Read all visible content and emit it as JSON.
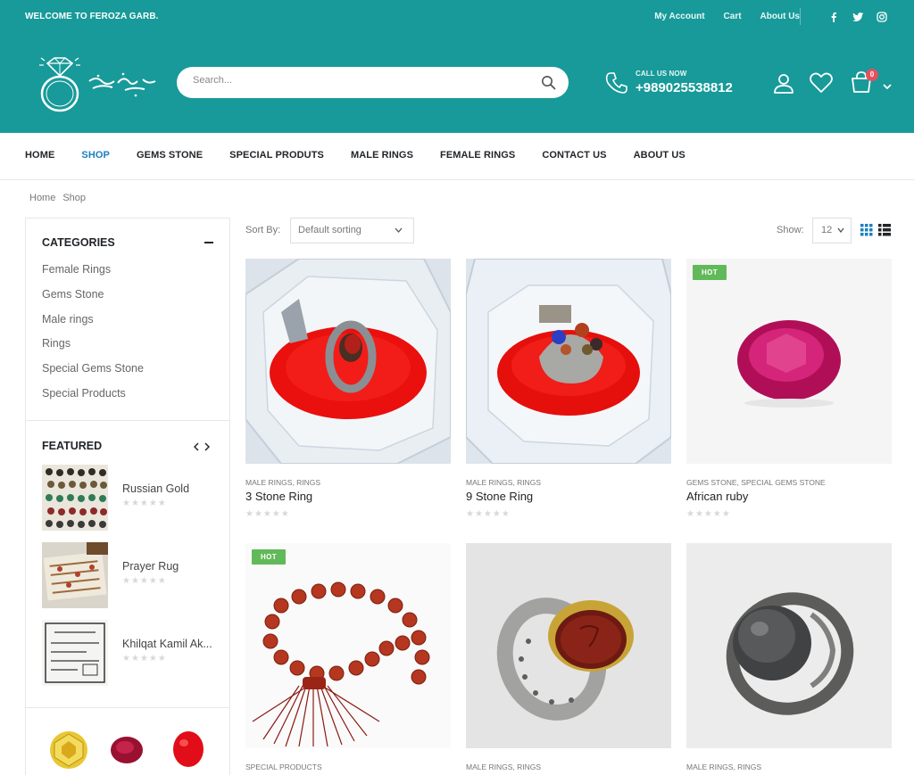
{
  "topbar": {
    "welcome": "WELCOME TO FEROZA GARB.",
    "links": [
      "My Account",
      "Cart",
      "About Us"
    ],
    "social_icons": [
      "facebook-icon",
      "twitter-icon",
      "instagram-icon"
    ]
  },
  "header": {
    "search_placeholder": "Search...",
    "call_label": "CALL US NOW",
    "phone": "+989025538812",
    "cart_count": "0"
  },
  "nav": {
    "items": [
      "HOME",
      "SHOP",
      "GEMS STONE",
      "SPECIAL PRODUTS",
      "MALE RINGS",
      "FEMALE RINGS",
      "CONTACT US",
      "ABOUT US"
    ],
    "active": "SHOP"
  },
  "breadcrumb": [
    "Home",
    "Shop"
  ],
  "sidebar": {
    "categories_title": "CATEGORIES",
    "categories": [
      "Female Rings",
      "Gems Stone",
      "Male rings",
      "Rings",
      "Special Gems Stone",
      "Special Products"
    ],
    "featured_title": "FEATURED",
    "featured": [
      {
        "name": "Russian Gold"
      },
      {
        "name": "Prayer Rug"
      },
      {
        "name": "Khilqat Kamil Ak..."
      }
    ]
  },
  "toolbar": {
    "sort_label": "Sort By:",
    "sort_value": "Default sorting",
    "show_label": "Show:",
    "show_value": "12"
  },
  "products": [
    {
      "cats": "MALE RINGS, RINGS",
      "name": "3 Stone Ring",
      "hot": ""
    },
    {
      "cats": "MALE RINGS, RINGS",
      "name": "9 Stone Ring",
      "hot": ""
    },
    {
      "cats": "GEMS STONE, SPECIAL GEMS STONE",
      "name": "African ruby",
      "hot": "HOT"
    },
    {
      "cats": "SPECIAL PRODUCTS",
      "name": "",
      "hot": "HOT"
    },
    {
      "cats": "MALE RINGS, RINGS",
      "name": "",
      "hot": ""
    },
    {
      "cats": "MALE RINGS, RINGS",
      "name": "",
      "hot": ""
    }
  ],
  "colors": {
    "teal": "#179a99",
    "active_nav": "#1b7fc1",
    "hot_badge": "#62b959",
    "cart_badge": "#e3505f"
  }
}
